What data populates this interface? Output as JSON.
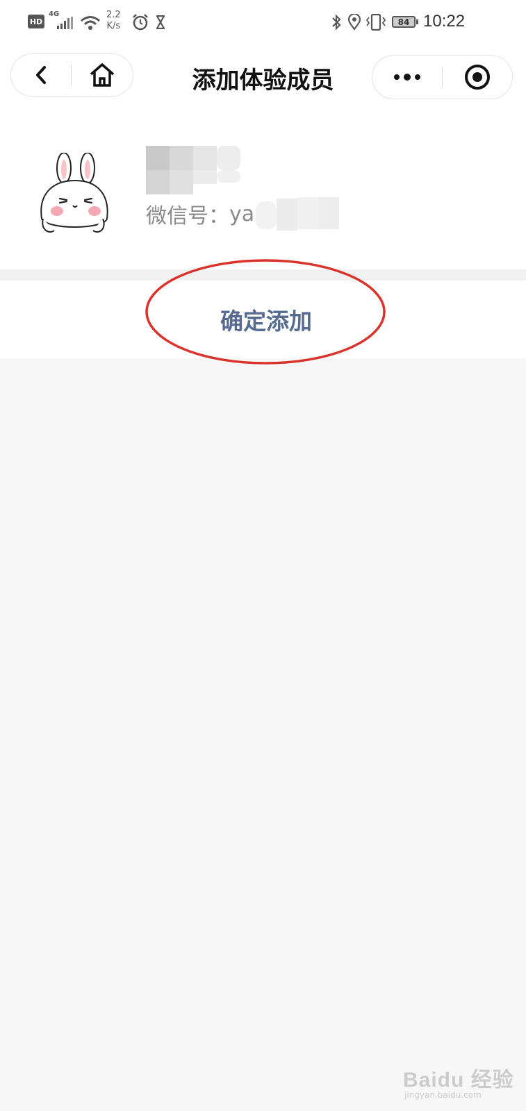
{
  "status_bar": {
    "hd_label": "HD",
    "network_label": "4G",
    "speed_value": "2.2",
    "speed_unit": "K/s",
    "battery_level": "84",
    "time": "10:22"
  },
  "nav": {
    "title": "添加体验成员",
    "back_icon": "chevron-left-icon",
    "home_icon": "home-icon",
    "more_icon": "more-dots-icon",
    "close_icon": "target-circle-icon"
  },
  "profile": {
    "wechat_label": "微信号：",
    "wechat_id_visible": "ya"
  },
  "actions": {
    "confirm_label": "确定添加"
  },
  "annotation": {
    "highlight_color": "#d9332b"
  },
  "watermark": {
    "brand": "Baidu 经验",
    "url": "jingyan.baidu.com"
  },
  "colors": {
    "confirm_text": "#566b8f",
    "background": "#f7f7f7"
  }
}
